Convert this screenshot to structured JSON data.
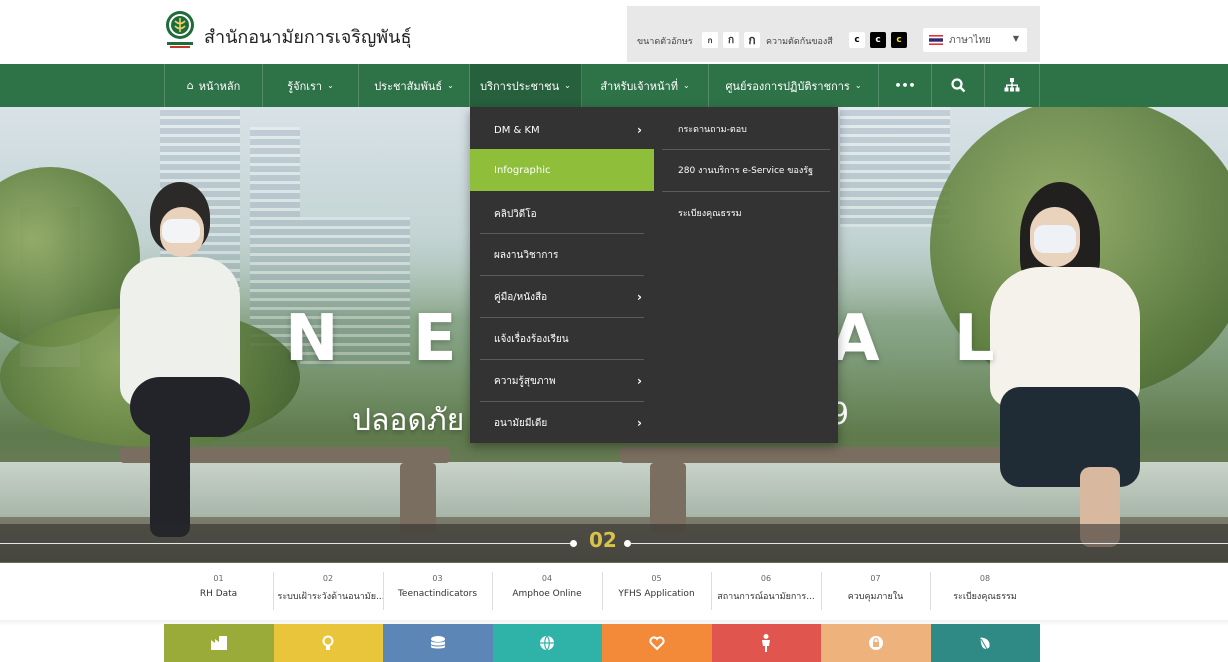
{
  "header": {
    "site_title": "สำนักอนามัยการเจริญพันธุ์",
    "font_size_label": "ขนาดตัวอักษร",
    "font_size_buttons": [
      "ก",
      "ก",
      "ก"
    ],
    "contrast_label": "ความตัดกันของสี",
    "contrast_buttons": [
      "c",
      "c",
      "c"
    ],
    "language_label": "ภาษาไทย"
  },
  "nav": {
    "items": [
      {
        "label": "หน้าหลัก",
        "icon": "home-icon"
      },
      {
        "label": "รู้จักเรา"
      },
      {
        "label": "ประชาสัมพันธ์"
      },
      {
        "label": "บริการประชาชน"
      },
      {
        "label": "สำหรับเจ้าหน้าที่"
      },
      {
        "label": "ศูนย์รองการปฏิบัติราชการ"
      }
    ],
    "more_label": "•••"
  },
  "dropdown": {
    "left_items": [
      {
        "label": "DM & KM",
        "has_sub": true
      },
      {
        "label": "Infographic",
        "has_sub": false
      },
      {
        "label": "คลิปวิดีโอ",
        "has_sub": false
      },
      {
        "label": "ผลงานวิชาการ",
        "has_sub": false
      },
      {
        "label": "คู่มือ/หนังสือ",
        "has_sub": true
      },
      {
        "label": "แจ้งเรื่องร้องเรียน",
        "has_sub": false
      },
      {
        "label": "ความรู้สุขภาพ",
        "has_sub": true
      },
      {
        "label": "อนามัยมีเดีย",
        "has_sub": true
      }
    ],
    "right_items": [
      "กระดานถาม-ตอบ",
      "280 งานบริการ e-Service ของรัฐ",
      "ระเบียงคุณธรรม"
    ]
  },
  "hero": {
    "headline_left": "N E W",
    "headline_right": "A L",
    "subline_left": "ปลอดภัย",
    "subline_right": "9",
    "slide_number": "02"
  },
  "quick_links": [
    {
      "num": "01",
      "label": "RH Data"
    },
    {
      "num": "02",
      "label": "ระบบเฝ้าระวังด้านอนามัย..."
    },
    {
      "num": "03",
      "label": "Teenactindicators"
    },
    {
      "num": "04",
      "label": "Amphoe Online"
    },
    {
      "num": "05",
      "label": "YFHS Application"
    },
    {
      "num": "06",
      "label": "สถานการณ์อนามัยการ..."
    },
    {
      "num": "07",
      "label": "ควบคุมภายใน"
    },
    {
      "num": "08",
      "label": "ระเบียงคุณธรรม"
    }
  ],
  "tile_colors": [
    "#9aab3a",
    "#e8c53a",
    "#5b86b5",
    "#2fb3a8",
    "#f28a3a",
    "#e0564e",
    "#eeb27d",
    "#2f8a86"
  ],
  "tile_icons": [
    "chart-icon",
    "lightbulb-icon",
    "database-icon",
    "globe-icon",
    "heart-icon",
    "person-icon",
    "lock-icon",
    "leaf-icon"
  ],
  "colors": {
    "nav_bg": "#2e7248",
    "dropdown_bg": "#333333",
    "dropdown_highlight": "#8ebe3a"
  }
}
